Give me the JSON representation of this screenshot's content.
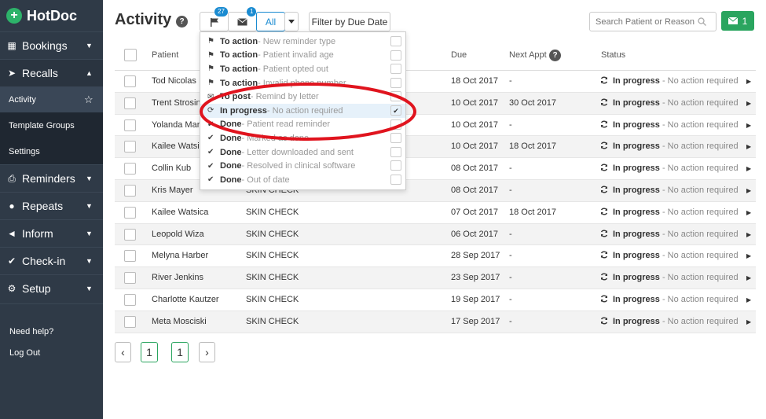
{
  "brand": {
    "name": "HotDoc",
    "logo_glyph": "+"
  },
  "sidebar": {
    "items": [
      {
        "label": "Bookings",
        "icon": "table-icon",
        "glyph": "▦",
        "caret": "▼"
      },
      {
        "label": "Recalls",
        "icon": "send-icon",
        "glyph": "➤",
        "caret": "▲",
        "subs": [
          {
            "label": "Activity",
            "star": "☆"
          },
          {
            "label": "Template Groups"
          },
          {
            "label": "Settings"
          }
        ]
      },
      {
        "label": "Reminders",
        "icon": "print-icon",
        "glyph": "⎙",
        "caret": "▼"
      },
      {
        "label": "Repeats",
        "icon": "pill-icon",
        "glyph": "●",
        "caret": "▼"
      },
      {
        "label": "Inform",
        "icon": "megaphone-icon",
        "glyph": "◄",
        "caret": "▼"
      },
      {
        "label": "Check-in",
        "icon": "check-circle-icon",
        "glyph": "✔",
        "caret": "▼"
      },
      {
        "label": "Setup",
        "icon": "gears-icon",
        "glyph": "⚙",
        "caret": "▼"
      }
    ],
    "bottom": [
      {
        "label": "Need help?"
      },
      {
        "label": "Log Out"
      }
    ]
  },
  "header": {
    "title": "Activity",
    "help": "?",
    "flag_badge": "27",
    "mail_badge": "1",
    "all_label": "All",
    "filter_label": "Filter by Due Date",
    "search_placeholder": "Search Patient or Reason",
    "message_count": "1"
  },
  "table": {
    "headers": {
      "patient": "Patient",
      "due": "Due",
      "next": "Next Appt",
      "status": "Status"
    },
    "rows": [
      {
        "name": "Tod Nicolas",
        "reason": "",
        "due": "18 Oct 2017",
        "next": "-",
        "status": "In progress",
        "status_note": " - No action required"
      },
      {
        "name": "Trent Strosin",
        "reason": "",
        "due": "10 Oct 2017",
        "next": "30 Oct 2017",
        "status": "In progress",
        "status_note": " - No action required"
      },
      {
        "name": "Yolanda Mar",
        "reason": "",
        "due": "10 Oct 2017",
        "next": "-",
        "status": "In progress",
        "status_note": " - No action required"
      },
      {
        "name": "Kailee Watsi",
        "reason": "",
        "due": "10 Oct 2017",
        "next": "18 Oct 2017",
        "status": "In progress",
        "status_note": " - No action required"
      },
      {
        "name": "Collin Kub",
        "reason": "",
        "due": "08 Oct 2017",
        "next": "-",
        "status": "In progress",
        "status_note": " - No action required"
      },
      {
        "name": "Kris Mayer",
        "reason": "SKIN CHECK",
        "due": "08 Oct 2017",
        "next": "-",
        "status": "In progress",
        "status_note": " - No action required"
      },
      {
        "name": "Kailee Watsica",
        "reason": "SKIN CHECK",
        "due": "07 Oct 2017",
        "next": "18 Oct 2017",
        "status": "In progress",
        "status_note": " - No action required"
      },
      {
        "name": "Leopold Wiza",
        "reason": "SKIN CHECK",
        "due": "06 Oct 2017",
        "next": "-",
        "status": "In progress",
        "status_note": " - No action required"
      },
      {
        "name": "Melyna Harber",
        "reason": "SKIN CHECK",
        "due": "28 Sep 2017",
        "next": "-",
        "status": "In progress",
        "status_note": " - No action required"
      },
      {
        "name": "River Jenkins",
        "reason": "SKIN CHECK",
        "due": "23 Sep 2017",
        "next": "-",
        "status": "In progress",
        "status_note": " - No action required"
      },
      {
        "name": "Charlotte Kautzer",
        "reason": "SKIN CHECK",
        "due": "19 Sep 2017",
        "next": "-",
        "status": "In progress",
        "status_note": " - No action required"
      },
      {
        "name": "Meta Mosciski",
        "reason": "SKIN CHECK",
        "due": "17 Sep 2017",
        "next": "-",
        "status": "In progress",
        "status_note": " - No action required"
      }
    ]
  },
  "pagination": {
    "prev": "‹",
    "next": "›",
    "pages": [
      "1",
      "1"
    ]
  },
  "dropdown": {
    "items": [
      {
        "icon": "flag-icon",
        "glyph": "⚑",
        "main": "To action",
        "sub": " - New reminder type",
        "checked": ""
      },
      {
        "icon": "flag-icon",
        "glyph": "⚑",
        "main": "To action",
        "sub": " - Patient invalid age",
        "checked": ""
      },
      {
        "icon": "flag-icon",
        "glyph": "⚑",
        "main": "To action",
        "sub": " - Patient opted out",
        "checked": ""
      },
      {
        "icon": "flag-icon",
        "glyph": "⚑",
        "main": "To action",
        "sub": " - Invalid phone number",
        "checked": ""
      },
      {
        "icon": "envelope-icon",
        "glyph": "✉",
        "main": "To post",
        "sub": " - Remind by letter",
        "checked": ""
      },
      {
        "icon": "refresh-icon",
        "glyph": "⟳",
        "main": "In progress",
        "sub": " - No action required",
        "checked": "✔"
      },
      {
        "icon": "check-icon",
        "glyph": "✔",
        "main": "Done",
        "sub": " - Patient read reminder",
        "checked": ""
      },
      {
        "icon": "check-icon",
        "glyph": "✔",
        "main": "Done",
        "sub": " - Marked as done",
        "checked": ""
      },
      {
        "icon": "check-icon",
        "glyph": "✔",
        "main": "Done",
        "sub": " - Letter downloaded and sent",
        "checked": ""
      },
      {
        "icon": "check-icon",
        "glyph": "✔",
        "main": "Done",
        "sub": " - Resolved in clinical software",
        "checked": ""
      },
      {
        "icon": "check-icon",
        "glyph": "✔",
        "main": "Done",
        "sub": " - Out of date",
        "checked": ""
      }
    ]
  },
  "colors": {
    "sidebar": "#2f3a47",
    "accent_green": "#2aa55f",
    "accent_blue": "#1a8bd1",
    "annotation_red": "#e0141e"
  }
}
